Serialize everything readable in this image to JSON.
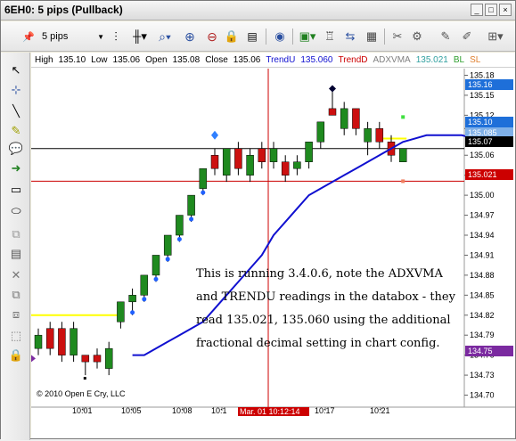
{
  "window": {
    "title": "6EH0: 5 pips (Pullback)"
  },
  "toolbar": {
    "interval": "5 pips",
    "items": [
      "pin-icon",
      "interval-dropdown",
      "bars-type-icon",
      "zoom-icon",
      "zoom-in-icon",
      "zoom-out-icon",
      "lock-icon",
      "properties-icon",
      "indicators-icon",
      "data-box-icon",
      "strategy-icon",
      "attach-icon",
      "settings-icon",
      "more-icon"
    ]
  },
  "databox": {
    "high_label": "High",
    "high": "135.10",
    "low_label": "Low",
    "low": "135.06",
    "open_label": "Open",
    "open": "135.08",
    "close_label": "Close",
    "close": "135.06",
    "trendu_label": "TrendU",
    "trendu": "135.060",
    "trendd_label": "TrendD",
    "adxvma_label": "ADXVMA",
    "adxvma": "135.021",
    "bl_label": "BL",
    "sl_label": "SL"
  },
  "note": "This is running 3.4.0.6, note the ADXVMA and TRENDU readings in the databox - they read 135.021, 135.060 using the additional fractional decimal setting in chart config.",
  "copyright": "© 2010 Open E Cry, LLC",
  "crosshair_label": "Mar. 01 10:12:14",
  "colors": {
    "up": "#1f8a1f",
    "down": "#cc1010",
    "adxvma": "#1010d0",
    "trendline": "#ffff00",
    "crosshair": "#cc0000"
  },
  "chart_data": {
    "type": "candlestick",
    "y_ticks": [
      "135.18",
      "135.15",
      "135.12",
      "135.10",
      "135.06",
      "135.03",
      "135.00",
      "134.97",
      "134.94",
      "134.91",
      "134.88",
      "134.85",
      "134.82",
      "134.79",
      "134.76",
      "134.73",
      "134.70"
    ],
    "x_ticks": [
      "10:01",
      "10:05",
      "10:08",
      "10:1",
      "10:17",
      "10:21"
    ],
    "price_badges": [
      {
        "label": "135.16",
        "color": "#1e6fd9"
      },
      {
        "label": "135.10",
        "color": "#1e6fd9"
      },
      {
        "label": "135.085",
        "color": "#7fb0e8"
      },
      {
        "label": "135.07",
        "color": "#000000"
      },
      {
        "label": "135.021",
        "color": "#cc0000"
      },
      {
        "label": "134.75",
        "color": "#7b2aa0"
      }
    ],
    "candles": [
      {
        "o": 134.77,
        "c": 134.79,
        "h": 134.8,
        "l": 134.76,
        "dir": "up"
      },
      {
        "o": 134.8,
        "c": 134.77,
        "h": 134.81,
        "l": 134.76,
        "dir": "down"
      },
      {
        "o": 134.8,
        "c": 134.76,
        "h": 134.81,
        "l": 134.75,
        "dir": "down"
      },
      {
        "o": 134.76,
        "c": 134.8,
        "h": 134.81,
        "l": 134.75,
        "dir": "up"
      },
      {
        "o": 134.76,
        "c": 134.75,
        "h": 134.76,
        "l": 134.73,
        "dir": "down"
      },
      {
        "o": 134.75,
        "c": 134.76,
        "h": 134.77,
        "l": 134.74,
        "dir": "down"
      },
      {
        "o": 134.74,
        "c": 134.77,
        "h": 134.78,
        "l": 134.73,
        "dir": "up"
      },
      {
        "o": 134.81,
        "c": 134.84,
        "h": 134.84,
        "l": 134.8,
        "dir": "up"
      },
      {
        "o": 134.84,
        "c": 134.85,
        "h": 134.86,
        "l": 134.82,
        "dir": "up"
      },
      {
        "o": 134.85,
        "c": 134.88,
        "h": 134.88,
        "l": 134.84,
        "dir": "up"
      },
      {
        "o": 134.88,
        "c": 134.91,
        "h": 134.91,
        "l": 134.87,
        "dir": "up"
      },
      {
        "o": 134.91,
        "c": 134.94,
        "h": 134.94,
        "l": 134.9,
        "dir": "up"
      },
      {
        "o": 134.94,
        "c": 134.97,
        "h": 134.97,
        "l": 134.93,
        "dir": "up"
      },
      {
        "o": 134.97,
        "c": 135.0,
        "h": 135.0,
        "l": 134.96,
        "dir": "up"
      },
      {
        "o": 135.01,
        "c": 135.04,
        "h": 135.04,
        "l": 135.0,
        "dir": "up"
      },
      {
        "o": 135.06,
        "c": 135.04,
        "h": 135.07,
        "l": 135.03,
        "dir": "down"
      },
      {
        "o": 135.03,
        "c": 135.07,
        "h": 135.07,
        "l": 135.02,
        "dir": "up"
      },
      {
        "o": 135.07,
        "c": 135.04,
        "h": 135.08,
        "l": 135.03,
        "dir": "down"
      },
      {
        "o": 135.03,
        "c": 135.06,
        "h": 135.07,
        "l": 135.02,
        "dir": "up"
      },
      {
        "o": 135.07,
        "c": 135.05,
        "h": 135.08,
        "l": 135.04,
        "dir": "down"
      },
      {
        "o": 135.05,
        "c": 135.07,
        "h": 135.08,
        "l": 135.04,
        "dir": "up"
      },
      {
        "o": 135.05,
        "c": 135.03,
        "h": 135.06,
        "l": 135.02,
        "dir": "down"
      },
      {
        "o": 135.04,
        "c": 135.05,
        "h": 135.06,
        "l": 135.03,
        "dir": "up"
      },
      {
        "o": 135.05,
        "c": 135.08,
        "h": 135.08,
        "l": 135.04,
        "dir": "up"
      },
      {
        "o": 135.08,
        "c": 135.11,
        "h": 135.11,
        "l": 135.07,
        "dir": "up"
      },
      {
        "o": 135.13,
        "c": 135.12,
        "h": 135.16,
        "l": 135.12,
        "dir": "down"
      },
      {
        "o": 135.1,
        "c": 135.13,
        "h": 135.14,
        "l": 135.09,
        "dir": "up"
      },
      {
        "o": 135.13,
        "c": 135.1,
        "h": 135.13,
        "l": 135.09,
        "dir": "down"
      },
      {
        "o": 135.08,
        "c": 135.1,
        "h": 135.11,
        "l": 135.06,
        "dir": "up"
      },
      {
        "o": 135.1,
        "c": 135.08,
        "h": 135.11,
        "l": 135.07,
        "dir": "down"
      },
      {
        "o": 135.08,
        "c": 135.06,
        "h": 135.09,
        "l": 135.05,
        "dir": "down"
      },
      {
        "o": 135.05,
        "c": 135.07,
        "h": 135.07,
        "l": 135.05,
        "dir": "up"
      }
    ],
    "adxvma": [
      134.76,
      134.76,
      134.77,
      134.78,
      134.79,
      134.8,
      134.81,
      134.83,
      134.85,
      134.87,
      134.89,
      134.91,
      134.94,
      134.96,
      134.98,
      135.0,
      135.01,
      135.02,
      135.03,
      135.04,
      135.05,
      135.06,
      135.07,
      135.08,
      135.085,
      135.09,
      135.09,
      135.09,
      135.09,
      135.085,
      135.085
    ],
    "yellow_level": 134.82,
    "hline_black": 135.07,
    "hline_red": 135.021
  }
}
